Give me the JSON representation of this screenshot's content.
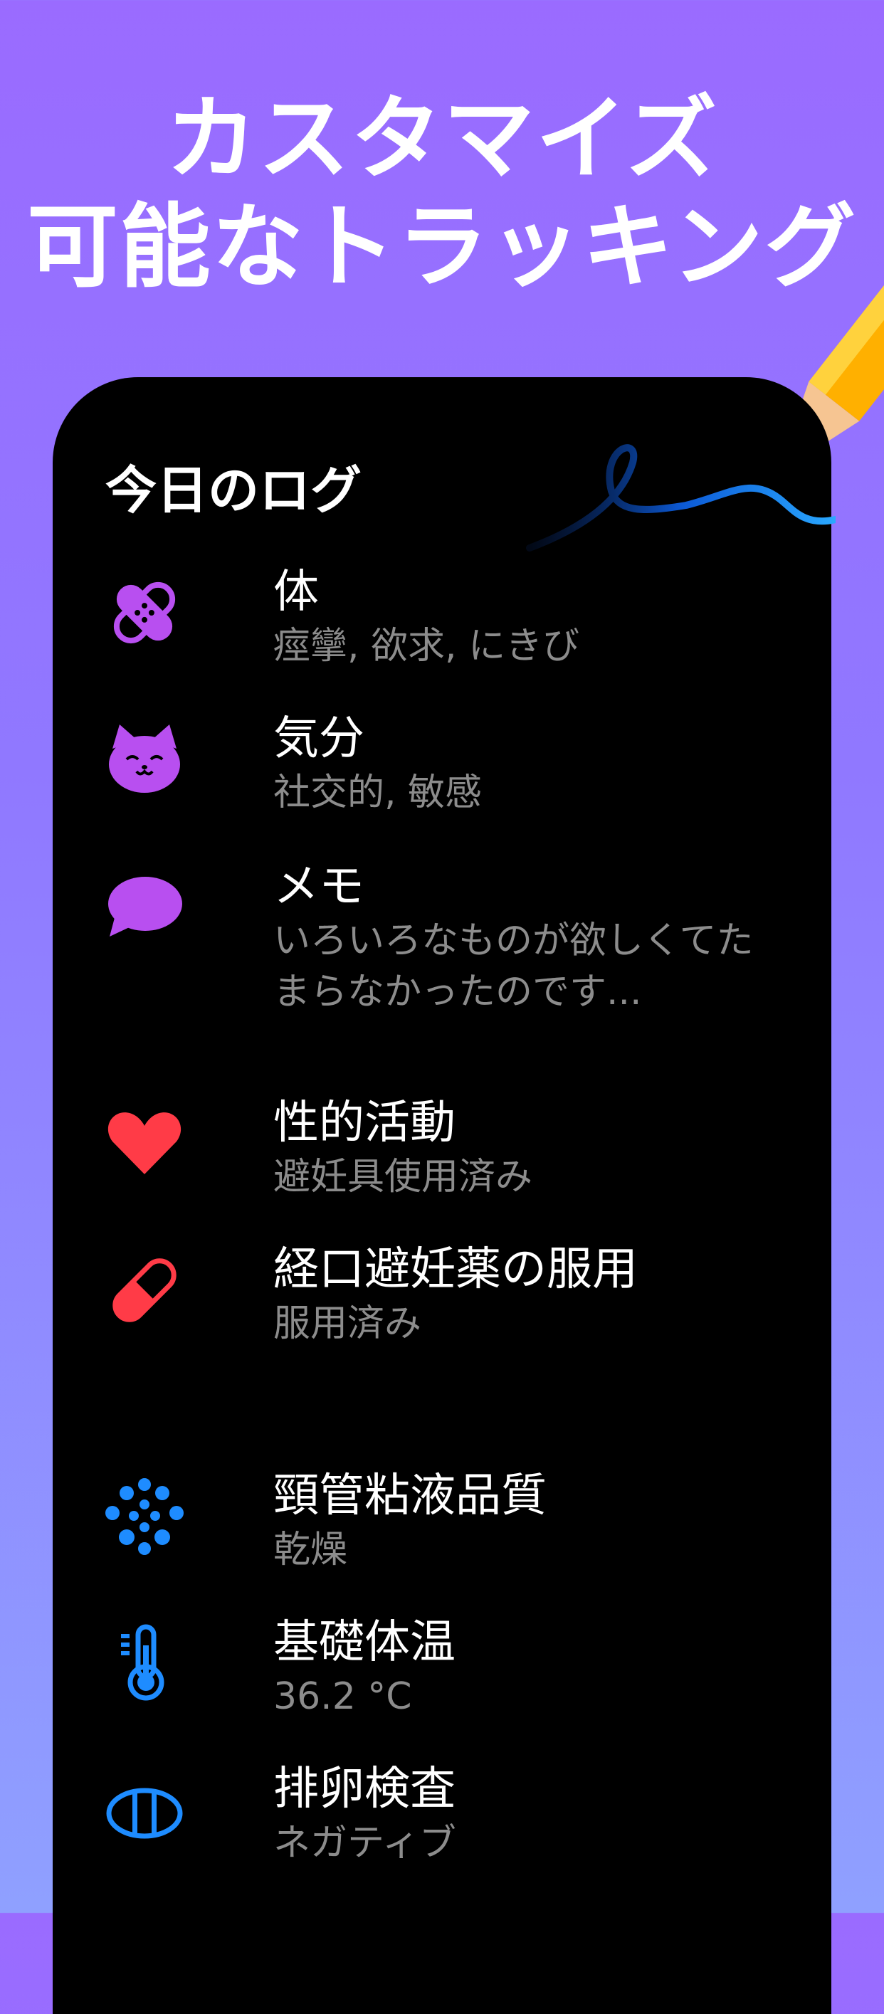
{
  "headline": {
    "line1": "カスタマイズ",
    "line2": "可能なトラッキング"
  },
  "log": {
    "title": "今日のログ",
    "items": [
      {
        "icon": "bandage-icon",
        "label": "体",
        "detail": "痙攣, 欲求, にきび",
        "color": "#b84ff0"
      },
      {
        "icon": "cat-face-icon",
        "label": "気分",
        "detail": "社交的, 敏感",
        "color": "#b84ff0"
      },
      {
        "icon": "speech-bubble-icon",
        "label": "メモ",
        "detail": "いろいろなものが欲しくてたまらなかったのです...",
        "color": "#b84ff0"
      },
      {
        "icon": "heart-icon",
        "label": "性的活動",
        "detail": "避妊具使用済み",
        "color": "#ff3b47"
      },
      {
        "icon": "pill-icon",
        "label": "経口避妊薬の服用",
        "detail": "服用済み",
        "color": "#ff3b47"
      },
      {
        "icon": "dots-cluster-icon",
        "label": "頸管粘液品質",
        "detail": "乾燥",
        "color": "#1e8cff"
      },
      {
        "icon": "thermometer-icon",
        "label": "基礎体温",
        "detail": "36.2 °C",
        "color": "#1e8cff"
      },
      {
        "icon": "ovulation-test-icon",
        "label": "排卵検査",
        "detail": "ネガティブ",
        "color": "#1e8cff"
      }
    ]
  },
  "colors": {
    "background_top": "#9a6bff",
    "background_bottom": "#8fa0ff",
    "phone": "#000000",
    "purple_accent": "#b84ff0",
    "red_accent": "#ff3b47",
    "blue_accent": "#1e8cff",
    "subtext": "#8c8c8c"
  }
}
